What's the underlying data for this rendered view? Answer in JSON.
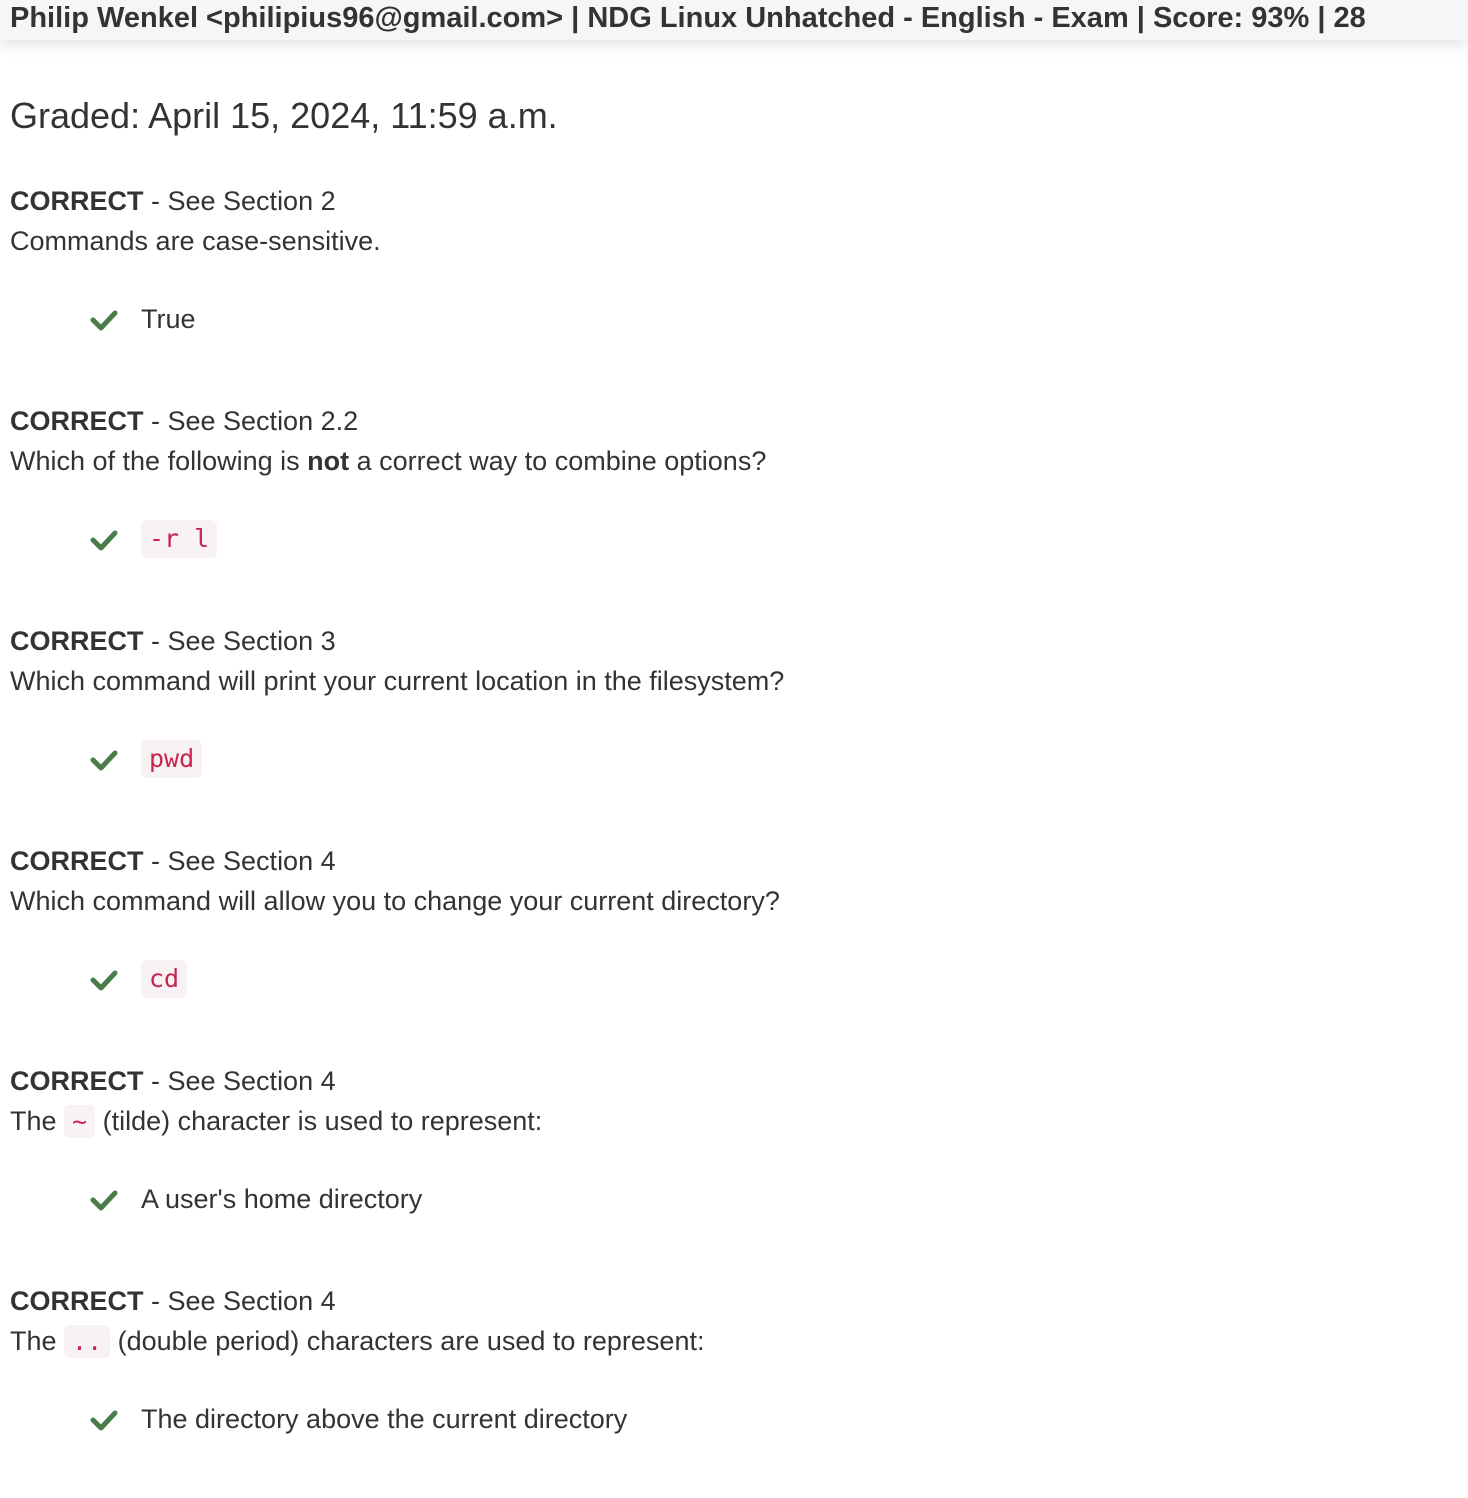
{
  "header": {
    "title": "Philip Wenkel <philipius96@gmail.com> | NDG Linux Unhatched - English - Exam | Score: 93% | 28"
  },
  "graded": "Graded: April 15, 2024, 11:59 a.m.",
  "colors": {
    "check": "#4a7c4a",
    "code_text": "#c7254e",
    "code_bg": "#f9f2f4",
    "header_bg": "#f6f6f6"
  },
  "questions": [
    {
      "status": "CORRECT",
      "section": " - See Section 2",
      "text": "Commands are case-sensitive.",
      "answer": "True",
      "answer_is_code": false
    },
    {
      "status": "CORRECT",
      "section": " - See Section 2.2",
      "text_before": "Which of the following is ",
      "text_bold": "not",
      "text_after": " a correct way to combine options?",
      "answer": "-r l",
      "answer_is_code": true
    },
    {
      "status": "CORRECT",
      "section": " - See Section 3",
      "text": "Which command will print your current location in the filesystem?",
      "answer": "pwd",
      "answer_is_code": true
    },
    {
      "status": "CORRECT",
      "section": " - See Section 4",
      "text": "Which command will allow you to change your current directory?",
      "answer": "cd",
      "answer_is_code": true
    },
    {
      "status": "CORRECT",
      "section": " - See Section 4",
      "text_before": "The ",
      "text_code": "~",
      "text_after": " (tilde) character is used to represent:",
      "answer": "A user's home directory",
      "answer_is_code": false
    },
    {
      "status": "CORRECT",
      "section": " - See Section 4",
      "text_before": "The ",
      "text_code": "..",
      "text_after": " (double period) characters are used to represent:",
      "answer": "The directory above the current directory",
      "answer_is_code": false
    }
  ]
}
